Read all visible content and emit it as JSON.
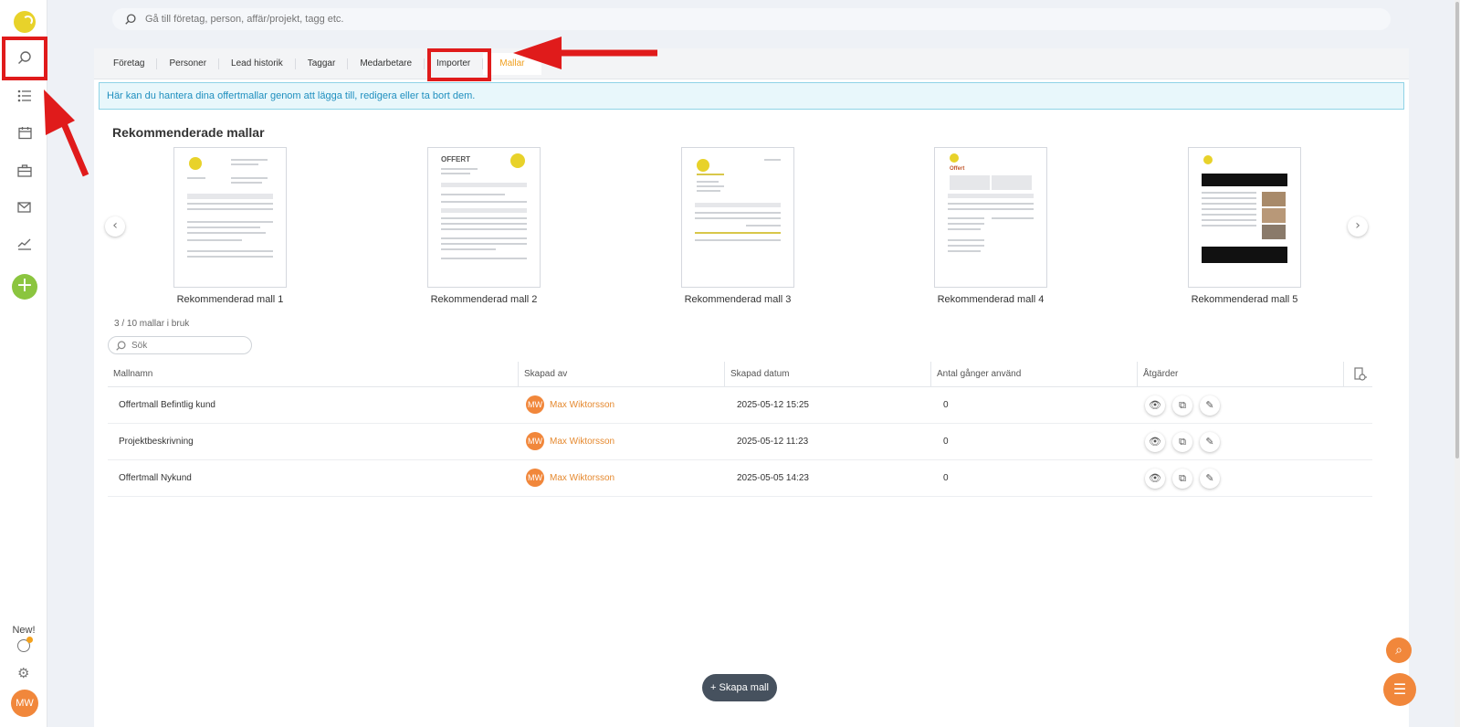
{
  "search": {
    "placeholder": "Gå till företag, person, affär/projekt, tagg etc."
  },
  "tabs": [
    {
      "label": "Företag"
    },
    {
      "label": "Personer"
    },
    {
      "label": "Lead historik"
    },
    {
      "label": "Taggar"
    },
    {
      "label": "Medarbetare"
    },
    {
      "label": "Importer"
    },
    {
      "label": "Mallar",
      "active": true
    }
  ],
  "info_text": "Här kan du hantera dina offertmallar genom att lägga till, redigera eller ta bort dem.",
  "recommended": {
    "title": "Rekommenderade mallar",
    "items": [
      {
        "label": "Rekommenderad mall 1"
      },
      {
        "label": "Rekommenderad mall 2",
        "heading": "OFFERT"
      },
      {
        "label": "Rekommenderad mall 3"
      },
      {
        "label": "Rekommenderad mall 4",
        "heading": "Offert"
      },
      {
        "label": "Rekommenderad mall 5"
      }
    ]
  },
  "usage_text": "3 / 10 mallar i bruk",
  "table_search": {
    "placeholder": "Sök"
  },
  "table": {
    "headers": [
      "Mallnamn",
      "Skapad av",
      "Skapad datum",
      "Antal gånger använd",
      "Åtgärder"
    ],
    "rows": [
      {
        "name": "Offertmall Befintlig kund",
        "initials": "MW",
        "creator": "Max Wiktorsson",
        "date": "2025-05-12 15:25",
        "count": "0"
      },
      {
        "name": "Projektbeskrivning",
        "initials": "MW",
        "creator": "Max Wiktorsson",
        "date": "2025-05-12 11:23",
        "count": "0"
      },
      {
        "name": "Offertmall Nykund",
        "initials": "MW",
        "creator": "Max Wiktorsson",
        "date": "2025-05-05 14:23",
        "count": "0"
      }
    ]
  },
  "create_button": "Skapa mall",
  "sidebar": {
    "new_label": "New!",
    "avatar_initials": "MW"
  },
  "colors": {
    "accent": "#f0a020",
    "annotation": "#e01b1b",
    "add": "#8bc53f",
    "avatar": "#f1873b"
  }
}
